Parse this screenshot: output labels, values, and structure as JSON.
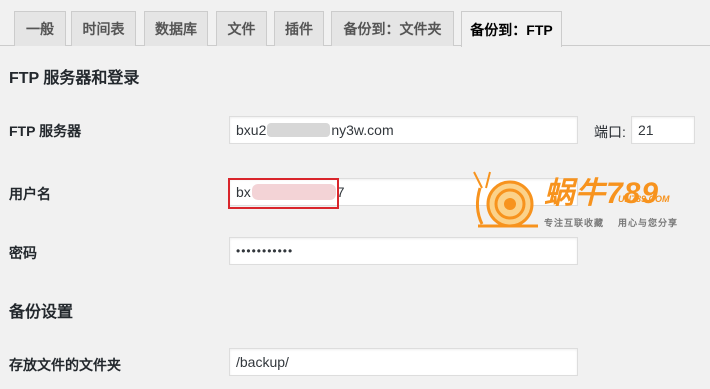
{
  "tabs": [
    {
      "label": "一般"
    },
    {
      "label": "时间表"
    },
    {
      "label": "数据库"
    },
    {
      "label": "文件"
    },
    {
      "label": "插件"
    },
    {
      "label": "备份到：文件夹"
    },
    {
      "label": "备份到：FTP",
      "active": true
    }
  ],
  "ftp_section": {
    "title": "FTP 服务器和登录",
    "server_label": "FTP 服务器",
    "server_value_start": "bxu2",
    "server_value_end": "ny3w.com",
    "port_label": "端口:",
    "port_value": "21",
    "username_label": "用户名",
    "username_value_start": "bx",
    "username_value_end": "7",
    "password_label": "密码",
    "password_value": "•••••••••••"
  },
  "backup_section": {
    "title": "备份设置",
    "folder_label": "存放文件的文件夹",
    "folder_value": "/backup/"
  },
  "watermark": {
    "brand": "蜗牛789",
    "url": "UN789.COM",
    "slogan_left": "专注互联收藏",
    "slogan_right": "用心与您分享"
  },
  "colors": {
    "background": "#f1f1f1",
    "highlight": "#d9252b",
    "watermark_orange": "#f7931e"
  }
}
